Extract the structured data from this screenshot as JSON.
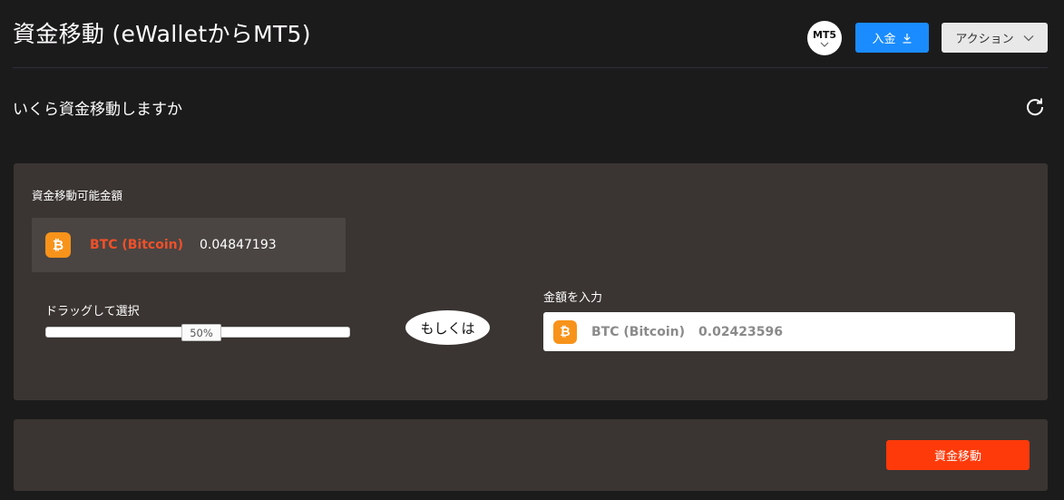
{
  "header": {
    "title": "資金移動 (eWalletからMT5)",
    "mt5_badge": "MT5",
    "deposit_label": "入金",
    "action_label": "アクション"
  },
  "section": {
    "subtitle": "いくら資金移動しますか"
  },
  "available": {
    "label": "資金移動可能金額",
    "currency": "BTC (Bitcoin)",
    "amount": "0.04847193",
    "coin_icon": "bitcoin-icon"
  },
  "slider": {
    "label": "ドラッグして選択",
    "value_text": "50%",
    "value": 0.5
  },
  "or_text": "もしくは",
  "amount_input": {
    "label": "金額を入力",
    "currency": "BTC (Bitcoin)",
    "value": "0.02423596"
  },
  "submit_label": "資金移動",
  "colors": {
    "background": "#1c1b1c",
    "card": "#3a3532",
    "accent_blue": "#1a8cff",
    "accent_red": "#ff3a0a",
    "btc_orange": "#f7931a",
    "currency_red": "#f0502a"
  }
}
